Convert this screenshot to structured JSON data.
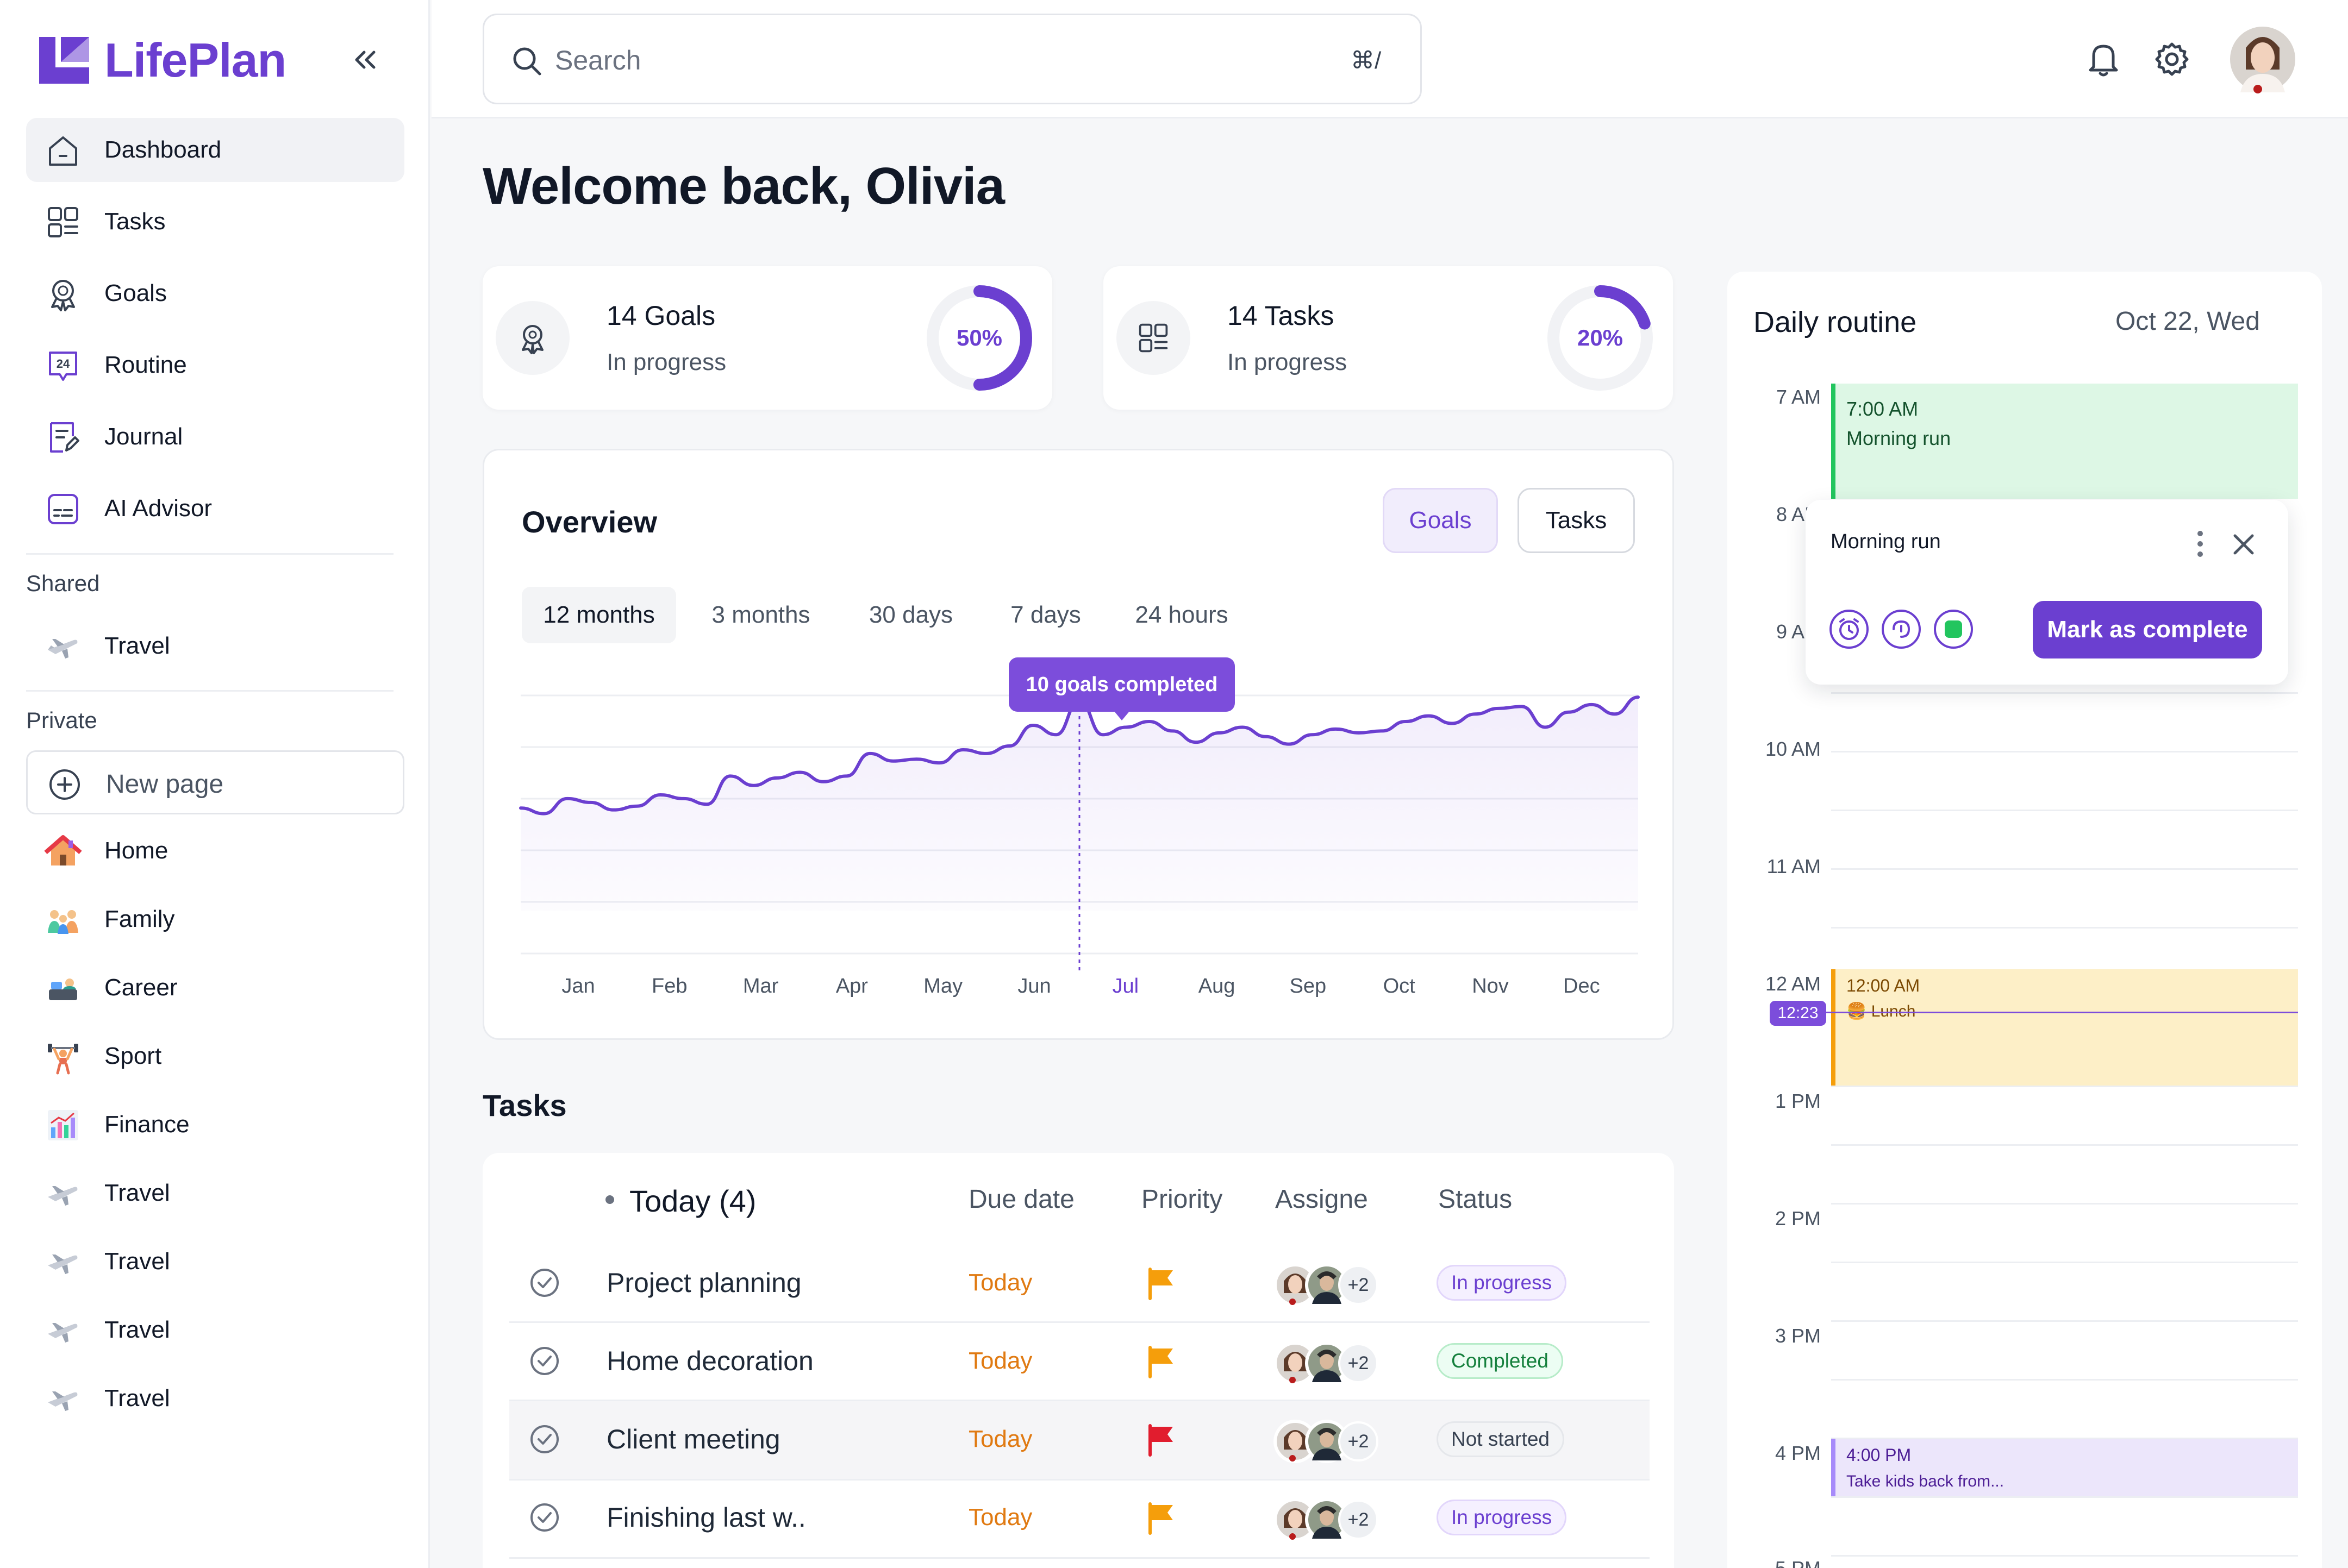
{
  "app": {
    "name": "LifePlan",
    "accent": "#6b3fd0"
  },
  "sidebar": {
    "main_items": [
      {
        "label": "Dashboard",
        "icon": "home-icon",
        "active": true
      },
      {
        "label": "Tasks",
        "icon": "grid-icon"
      },
      {
        "label": "Goals",
        "icon": "award-icon"
      },
      {
        "label": "Routine",
        "icon": "routine-24-icon"
      },
      {
        "label": "Journal",
        "icon": "journal-icon"
      },
      {
        "label": "AI Advisor",
        "icon": "ai-advisor-icon"
      }
    ],
    "shared_label": "Shared",
    "shared_items": [
      {
        "label": "Travel",
        "icon": "airplane-icon"
      }
    ],
    "private_label": "Private",
    "new_page_label": "New page",
    "private_items": [
      {
        "label": "Home",
        "icon": "house-emoji"
      },
      {
        "label": "Family",
        "icon": "family-emoji"
      },
      {
        "label": "Career",
        "icon": "career-emoji"
      },
      {
        "label": "Sport",
        "icon": "sport-emoji"
      },
      {
        "label": "Finance",
        "icon": "finance-emoji"
      },
      {
        "label": "Travel",
        "icon": "airplane-icon"
      },
      {
        "label": "Travel",
        "icon": "airplane-icon"
      },
      {
        "label": "Travel",
        "icon": "airplane-icon"
      },
      {
        "label": "Travel",
        "icon": "airplane-icon"
      }
    ]
  },
  "header": {
    "search_placeholder": "Search",
    "search_shortcut": "⌘/"
  },
  "main": {
    "welcome": "Welcome back, Olivia",
    "stats": [
      {
        "title": "14 Goals",
        "sub": "In progress",
        "percent_label": "50%",
        "percent": 50
      },
      {
        "title": "14 Tasks",
        "sub": "In progress",
        "percent_label": "20%",
        "percent": 20
      }
    ],
    "overview": {
      "title": "Overview",
      "toggle": [
        "Goals",
        "Tasks"
      ],
      "ranges": [
        "12 months",
        "3 months",
        "30 days",
        "7 days",
        "24 hours"
      ],
      "tooltip": "10 goals completed"
    },
    "tasks": {
      "title": "Tasks",
      "group_label": "Today (4)",
      "columns": [
        "Due date",
        "Priority",
        "Assigne",
        "Status"
      ],
      "rows": [
        {
          "name": "Project planning",
          "due": "Today",
          "priority": "orange",
          "extra": "+2",
          "status": "In progress"
        },
        {
          "name": "Home decoration",
          "due": "Today",
          "priority": "orange",
          "extra": "+2",
          "status": "Completed"
        },
        {
          "name": "Client meeting",
          "due": "Today",
          "priority": "red",
          "extra": "+2",
          "status": "Not started"
        },
        {
          "name": "Finishing last w..",
          "due": "Today",
          "priority": "orange",
          "extra": "+2",
          "status": "In progress"
        }
      ]
    }
  },
  "chart_data": {
    "type": "line",
    "title": "",
    "xlabel": "",
    "ylabel": "",
    "categories": [
      "Jan",
      "Feb",
      "Mar",
      "Apr",
      "May",
      "Jun",
      "Jul",
      "Aug",
      "Sep",
      "Oct",
      "Nov",
      "Dec"
    ],
    "highlight": "Jul",
    "grid": true,
    "ylim": [
      0,
      10
    ],
    "x": [
      0,
      0.25,
      0.5,
      0.75,
      1,
      1.25,
      1.5,
      1.75,
      2,
      2.25,
      2.5,
      2.75,
      3,
      3.25,
      3.5,
      3.75,
      4,
      4.25,
      4.5,
      4.75,
      5,
      5.25,
      5.5,
      5.75,
      6,
      6.25,
      6.5,
      6.75,
      7,
      7.25,
      7.5,
      7.75,
      8,
      8.25,
      8.5,
      8.75,
      9,
      9.25,
      9.5,
      9.75,
      10,
      10.25,
      10.5,
      10.75,
      11,
      11.25,
      11.5,
      11.75,
      12
    ],
    "values": [
      4.3,
      4.0,
      4.8,
      4.6,
      4.2,
      4.4,
      5.0,
      4.8,
      4.5,
      6.0,
      5.5,
      5.9,
      6.2,
      5.7,
      6.0,
      7.2,
      6.8,
      6.9,
      6.7,
      7.4,
      7.2,
      7.6,
      8.7,
      8.2,
      10.0,
      8.2,
      8.6,
      8.9,
      8.4,
      7.8,
      8.3,
      8.6,
      8.1,
      7.7,
      8.2,
      8.5,
      8.3,
      8.4,
      8.9,
      9.2,
      8.8,
      9.3,
      9.6,
      9.7,
      8.6,
      9.4,
      9.8,
      9.3,
      10.2
    ]
  },
  "routine": {
    "title": "Daily routine",
    "date": "Oct 22, Wed",
    "hours": [
      "7 AM",
      "8 AM",
      "9 AM",
      "10 AM",
      "11 AM",
      "12 AM",
      "1 PM",
      "2 PM",
      "3 PM",
      "4 PM",
      "5 PM"
    ],
    "now_label": "12:23",
    "events": [
      {
        "time": "7:00  AM",
        "title": "Morning run",
        "color": "#22c55e"
      },
      {
        "time": "12:00  AM",
        "title": "🍔 Lunch",
        "color": "#f59e0b"
      },
      {
        "time": "4:00  PM",
        "title": "Take kids back from...",
        "color": "#a78bfa"
      }
    ],
    "popup": {
      "title": "Morning run",
      "action": "Mark as complete"
    }
  }
}
